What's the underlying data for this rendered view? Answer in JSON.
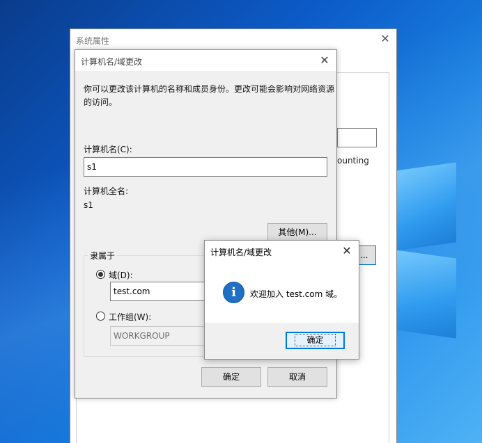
{
  "system_properties": {
    "title": "系统属性",
    "bg_partial_text": "ounting",
    "bg_button_fragment": "..."
  },
  "computer_name_dialog": {
    "title": "计算机名/域更改",
    "description": "你可以更改该计算机的名称和成员身份。更改可能会影响对网络资源的访问。",
    "computer_name_label": "计算机名(C):",
    "computer_name_value": "s1",
    "full_name_label": "计算机全名:",
    "full_name_value": "s1",
    "more_button": "其他(M)...",
    "member_of_label": "隶属于",
    "domain_label": "域(D):",
    "domain_value": "test.com",
    "domain_selected": true,
    "workgroup_label": "工作组(W):",
    "workgroup_value": "WORKGROUP",
    "ok_button": "确定",
    "cancel_button": "取消"
  },
  "message_box": {
    "title": "计算机名/域更改",
    "icon": "info-icon",
    "message": "欢迎加入 test.com 域。",
    "ok_button": "确定"
  },
  "colors": {
    "accent": "#0078d7",
    "dialog_bg": "#f0f0f0",
    "info_icon": "#1f6fc5"
  }
}
